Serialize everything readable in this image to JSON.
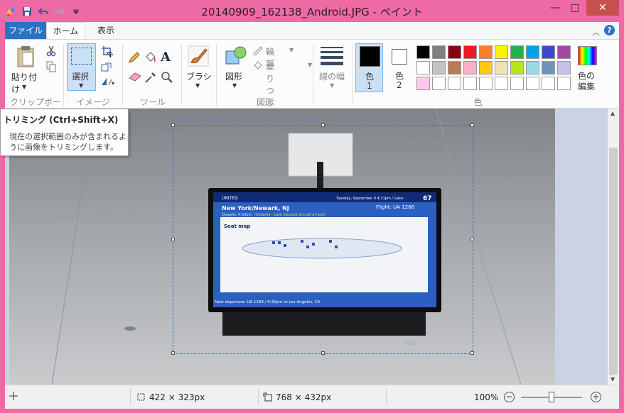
{
  "window": {
    "title": "20140909_162138_Android.JPG - ペイント",
    "minimize_glyph": "—",
    "maximize_glyph": "□",
    "close_glyph": "✕"
  },
  "tabs": [
    {
      "label": "ファイル"
    },
    {
      "label": "ホーム"
    },
    {
      "label": "表示"
    }
  ],
  "ribbon": {
    "clipboard": {
      "paste_label": "貼り付け",
      "group_label": "クリップボード"
    },
    "image": {
      "select_label": "選択",
      "group_label": "イメージ"
    },
    "tools": {
      "group_label": "ツール"
    },
    "brush": {
      "label": "ブラシ"
    },
    "shapes": {
      "shapes_label": "図形",
      "outline_label": "輪郭",
      "fill_label": "塗りつぶし",
      "group_label": "図形"
    },
    "size": {
      "label": "線の幅"
    },
    "colors": {
      "color1_label": "色",
      "color1_num": "1",
      "color2_label": "色",
      "color2_num": "2",
      "edit_label_line1": "色の",
      "edit_label_line2": "編集",
      "group_label": "色",
      "color1": "#000000",
      "color2": "#ffffff",
      "palette_row1": [
        "#000000",
        "#7f7f7f",
        "#880015",
        "#ed1c24",
        "#ff7f27",
        "#fff200",
        "#22b14c",
        "#00a2e8",
        "#3f48cc",
        "#a349a4"
      ],
      "palette_row2": [
        "#ffffff",
        "#c3c3c3",
        "#b97a57",
        "#ffaec9",
        "#ffc90e",
        "#efe4b0",
        "#b5e61d",
        "#99d9ea",
        "#7092be",
        "#c8bfe7"
      ],
      "palette_row3": [
        "#ffc6ef",
        "#ffffff",
        "#ffffff",
        "#ffffff",
        "#ffffff",
        "#ffffff",
        "#ffffff",
        "#ffffff",
        "#ffffff",
        "#ffffff"
      ]
    }
  },
  "tooltip": {
    "title": "トリミング (Ctrl+Shift+X)",
    "body": "現在の選択範囲のみが含まれるように画像をトリミングします。"
  },
  "photo": {
    "brand": "UNITED",
    "date_gate": "Tuesday, September 9  4:31pm  /  Gate:",
    "gate": "67",
    "destination": "New York/Newark, NJ",
    "flight": "Flight: UA 1266",
    "departs": "Departs: 4:50pm",
    "delayed": "(Delayed - Late inbound aircraft arrival)",
    "seat_map": "Seat map",
    "next": "Next departure: UA 1169 / 6:30pm to Los Angeles, CA"
  },
  "statusbar": {
    "selection_size": "422 × 323px",
    "image_size": "768 × 432px",
    "zoom": "100%",
    "zoom_out": "−",
    "zoom_in": "+",
    "zoom_level": 0.5
  }
}
